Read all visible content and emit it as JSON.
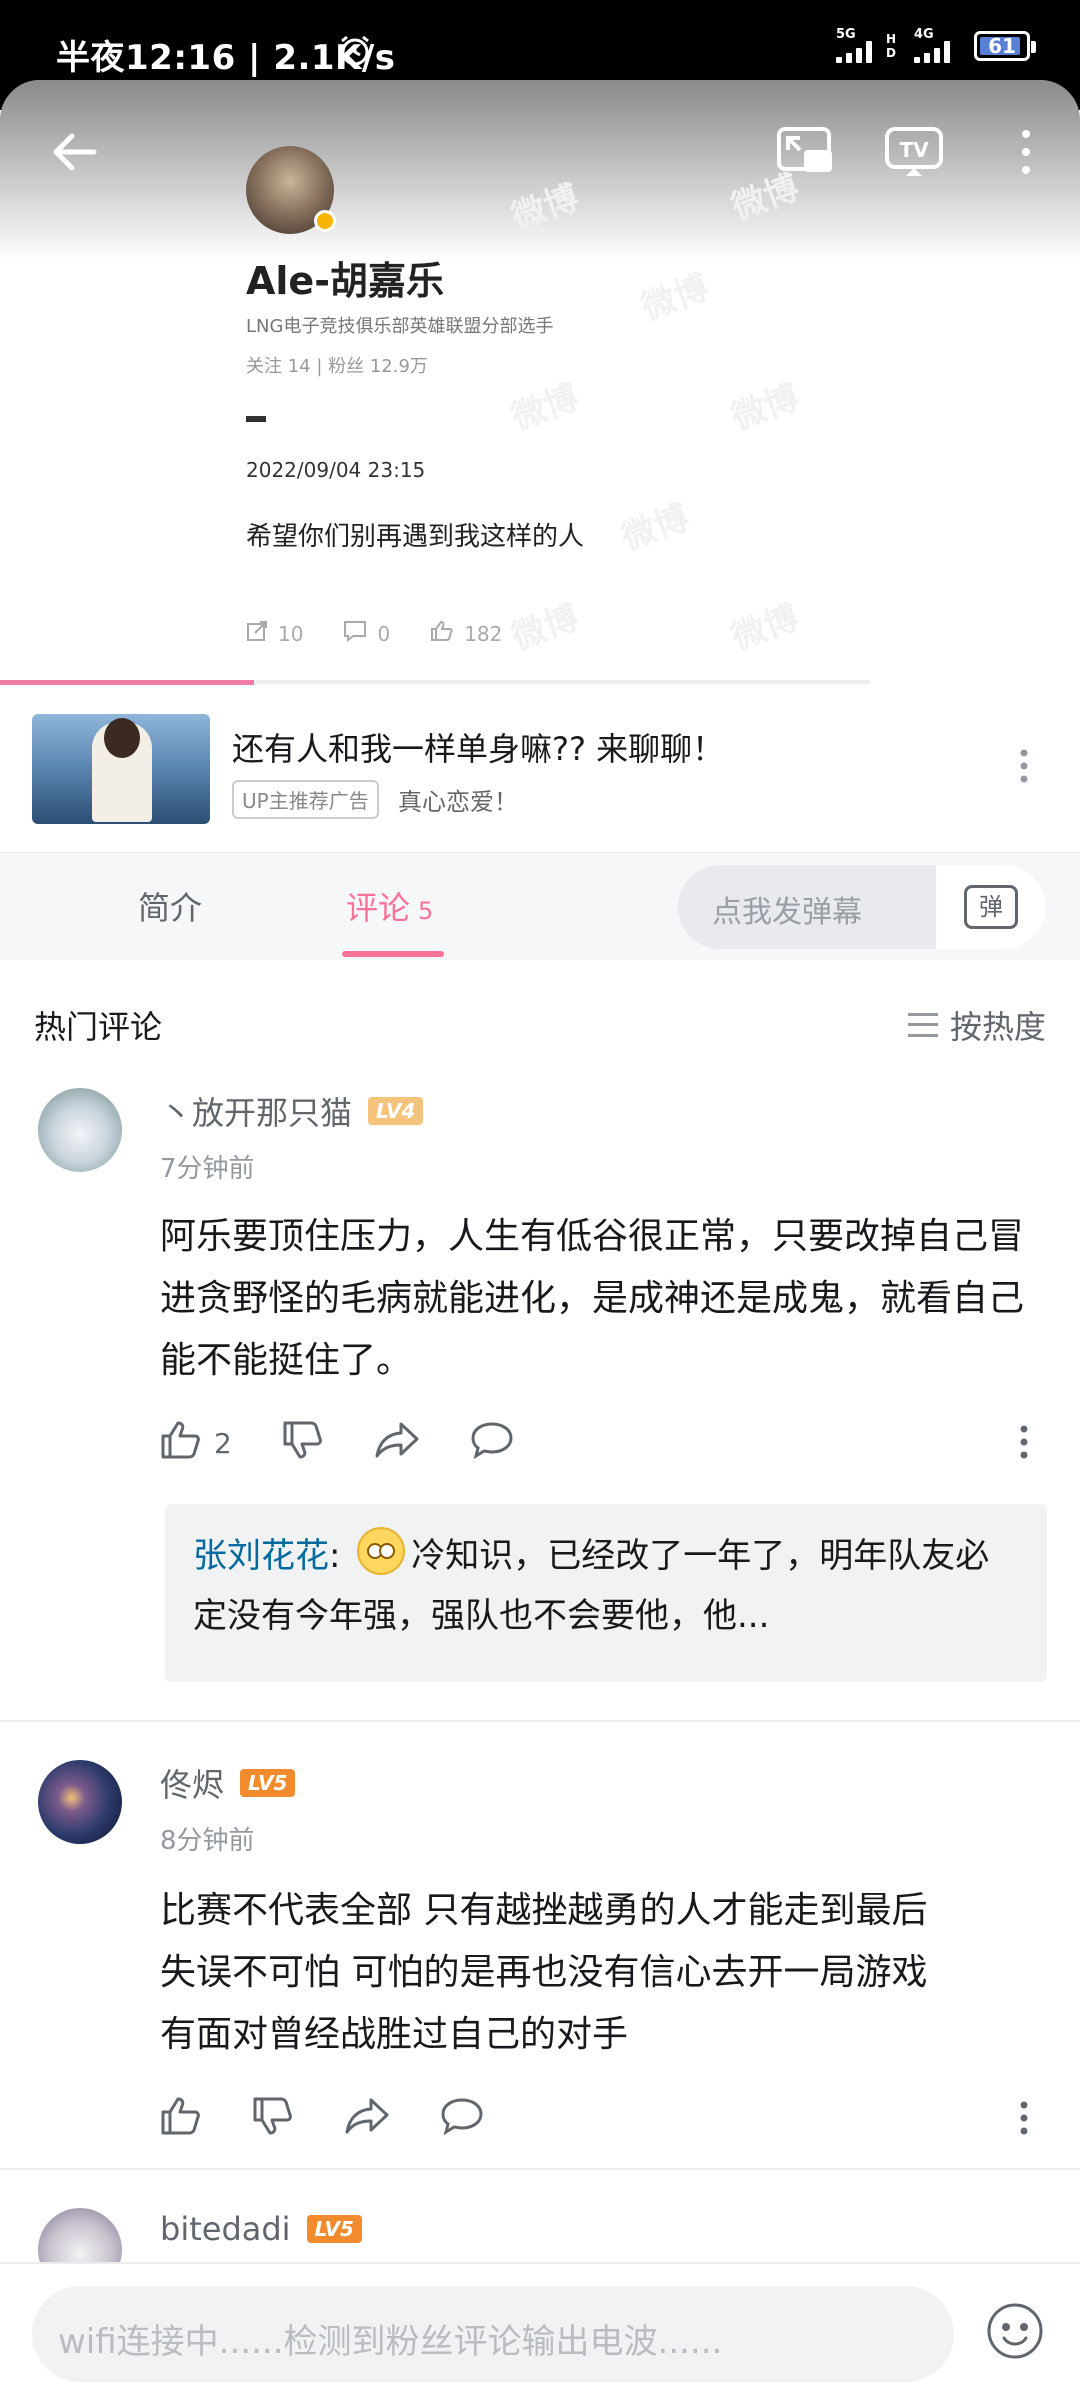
{
  "status_bar": {
    "time": "半夜12:16 | 2.1K/s",
    "net1": "5G",
    "net2": "4G",
    "hd": "H D",
    "battery": "61"
  },
  "video": {
    "weibo_name": "Ale-胡嘉乐",
    "weibo_desc": "LNG电子竞技俱乐部英雄联盟分部选手",
    "weibo_stats": "关注 14  |  粉丝 12.9万",
    "weibo_date": "2022/09/04 23:15",
    "weibo_text": "希望你们别再遇到我这样的人",
    "weibo_repost": "10",
    "weibo_comment": "0",
    "weibo_like": "182",
    "watermark": "微博",
    "progress_fraction": 0.235
  },
  "ad": {
    "title": "还有人和我一样单身嘛?? 来聊聊！",
    "tag": "UP主推荐广告",
    "subtitle": "真心恋爱！"
  },
  "tabs": {
    "intro": "简介",
    "comments": "评论",
    "comments_count": "5",
    "danmu_placeholder": "点我发弹幕",
    "danmu_btn": "弹"
  },
  "comments_header": {
    "title": "热门评论",
    "sort": "按热度"
  },
  "comments": [
    {
      "user": "丶放开那只猫",
      "level": "LV4",
      "time": "7分钟前",
      "text": "阿乐要顶住压力，人生有低谷很正常，只要改掉自己冒进贪野怪的毛病就能进化，是成神还是成鬼，就看自己能不能挺住了。",
      "likes": "2",
      "reply": {
        "user": "张刘花花",
        "text": "冷知识，已经改了一年了，明年队友必定没有今年强，强队也不会要他，他..."
      }
    },
    {
      "user": "佟烬",
      "level": "LV5",
      "time": "8分钟前",
      "text_lines": [
        "比赛不代表全部 只有越挫越勇的人才能走到最后",
        "失误不可怕 可怕的是再也没有信心去开一局游戏",
        "有面对曾经战胜过自己的对手"
      ]
    },
    {
      "user": "bitedadi",
      "level": "LV5"
    }
  ],
  "bottom_input": {
    "placeholder": "wifi连接中......检测到粉丝评论输出电波......"
  },
  "colors": {
    "accent": "#fb7299",
    "reply_name": "#00699d"
  }
}
